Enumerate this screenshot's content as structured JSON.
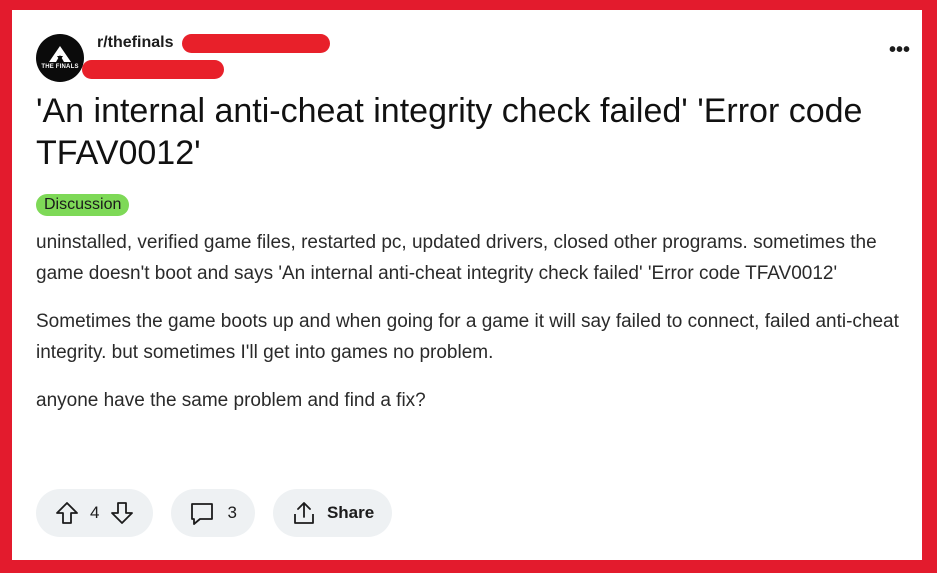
{
  "post": {
    "subreddit": "r/thefinals",
    "avatar_text": "THE FINALS",
    "title": "'An internal anti-cheat integrity check failed' 'Error code TFAV0012'",
    "flair": "Discussion",
    "body": [
      "uninstalled, verified game files, restarted pc, updated drivers, closed other programs. sometimes the game doesn't boot and says 'An internal anti-cheat integrity check failed' 'Error code TFAV0012'",
      "Sometimes the game boots up and when going for a game it will say failed to connect, failed anti-cheat integrity. but sometimes I'll get into games no problem.",
      "anyone have the same problem and find a fix?"
    ],
    "more_label": "•••"
  },
  "actions": {
    "votes": "4",
    "comments": "3",
    "share_label": "Share"
  },
  "colors": {
    "frame": "#e31b2d",
    "flair": "#7ed957",
    "pill": "#eef1f3"
  }
}
